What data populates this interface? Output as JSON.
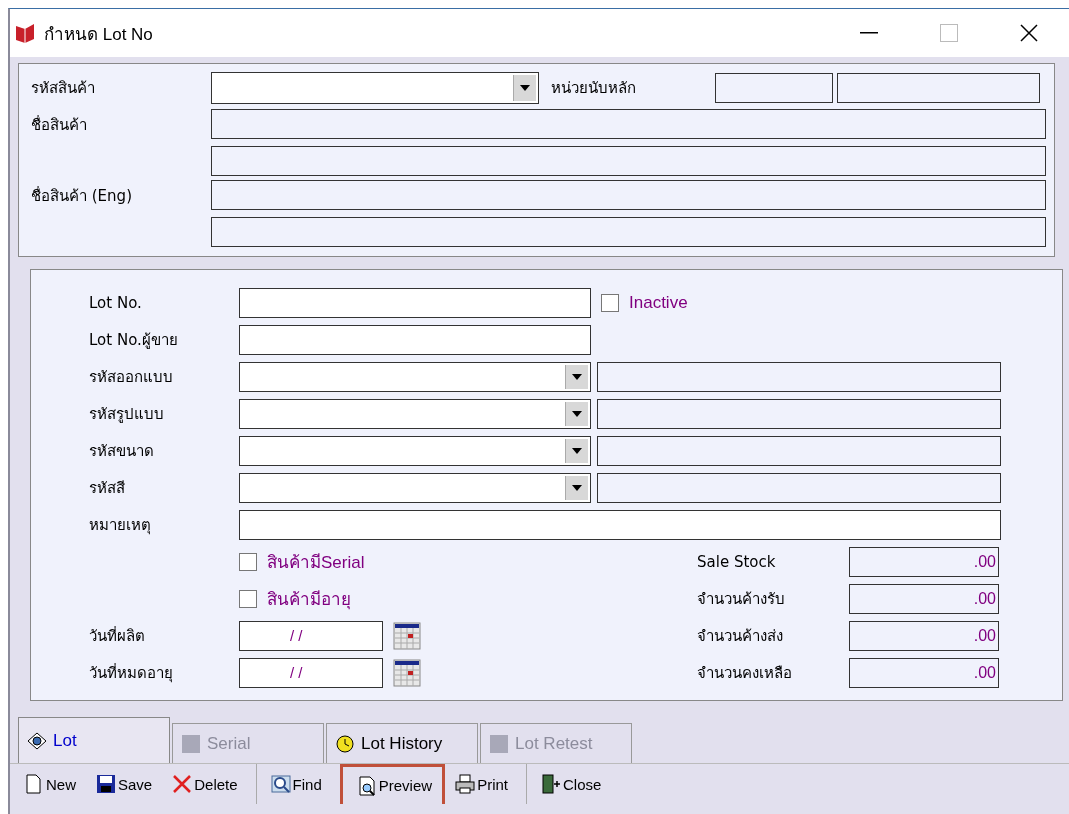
{
  "window": {
    "title": "กำหนด Lot No"
  },
  "product": {
    "code_label": "รหัสสินค้า",
    "unit_label": "หน่วยนับหลัก",
    "name_label": "ชื่อสินค้า",
    "name_eng_label": "ชื่อสินค้า (Eng)"
  },
  "lot": {
    "rows": [
      {
        "kind": "text",
        "label": "Lot No.",
        "inactive": {
          "label": "Inactive",
          "checked": false
        }
      },
      {
        "kind": "text",
        "label": "Lot No.ผู้ขาย"
      },
      {
        "kind": "combo",
        "label": "รหัสออกแบบ"
      },
      {
        "kind": "combo",
        "label": "รหัสรูปแบบ"
      },
      {
        "kind": "combo",
        "label": "รหัสขนาด"
      },
      {
        "kind": "combo",
        "label": "รหัสสี"
      },
      {
        "kind": "wide",
        "label": "หมายเหตุ"
      }
    ],
    "checks": [
      {
        "label": "สินค้ามีSerial",
        "checked": false
      },
      {
        "label": "สินค้ามีอายุ",
        "checked": false
      }
    ],
    "dates": [
      {
        "label": "วันที่ผลิต",
        "value": "/ /"
      },
      {
        "label": "วันที่หมดอายุ",
        "value": "/ /"
      }
    ],
    "stock": [
      {
        "label": "Sale Stock",
        "value": ".00"
      },
      {
        "label": "จำนวนค้างรับ",
        "value": ".00"
      },
      {
        "label": "จำนวนค้างส่ง",
        "value": ".00"
      },
      {
        "label": "จำนวนคงเหลือ",
        "value": ".00"
      }
    ]
  },
  "tabs": [
    {
      "label": "Lot",
      "selected": true,
      "disabled": false
    },
    {
      "label": "Serial",
      "selected": false,
      "disabled": true
    },
    {
      "label": "Lot History",
      "selected": false,
      "disabled": false
    },
    {
      "label": "Lot Retest",
      "selected": false,
      "disabled": true
    }
  ],
  "toolbar": [
    {
      "label": "New",
      "highlighted": false,
      "group_start": false
    },
    {
      "label": "Save",
      "highlighted": false,
      "group_start": false
    },
    {
      "label": "Delete",
      "highlighted": false,
      "group_start": false
    },
    {
      "label": "Find",
      "highlighted": false,
      "group_start": true
    },
    {
      "label": "Preview",
      "highlighted": true,
      "group_start": true
    },
    {
      "label": "Print",
      "highlighted": false,
      "group_start": false
    },
    {
      "label": "Close",
      "highlighted": false,
      "group_start": true
    }
  ]
}
